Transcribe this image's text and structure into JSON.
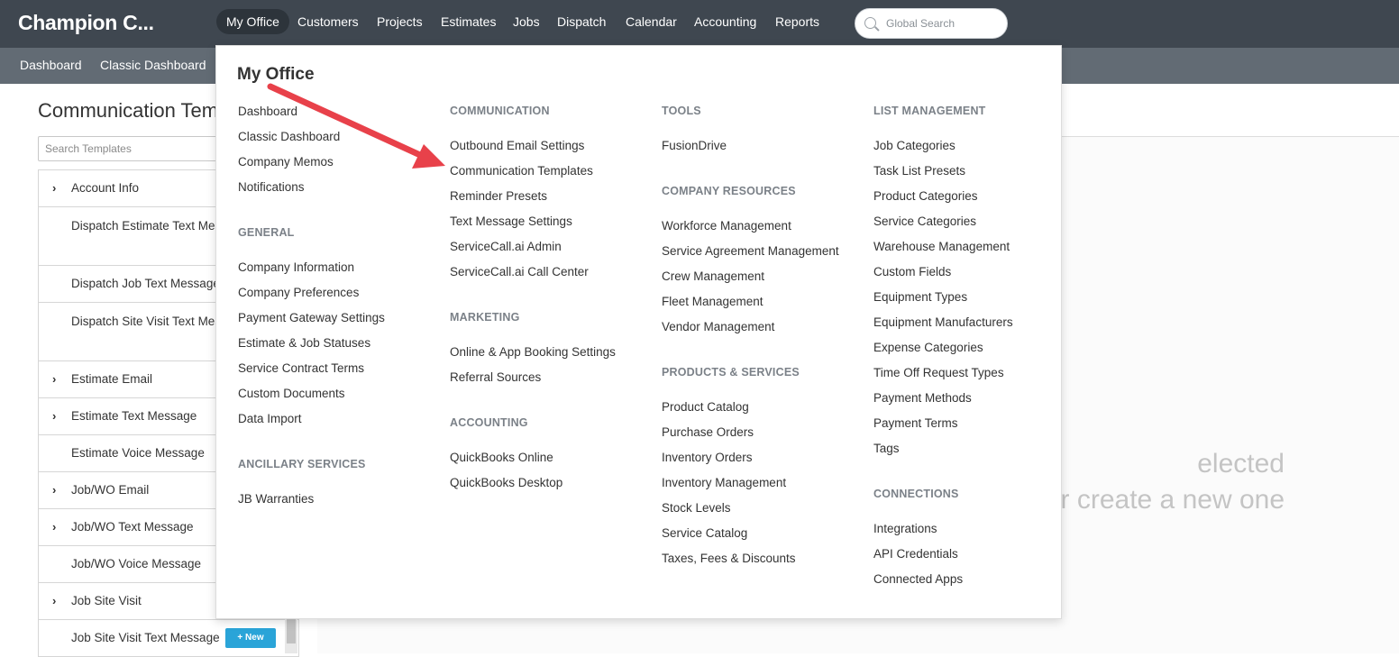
{
  "brand": "Champion C...",
  "nav": {
    "items": [
      "My Office",
      "Customers",
      "Projects",
      "Estimates",
      "Jobs",
      "Dispatch",
      "Calendar",
      "Accounting",
      "Reports"
    ],
    "active": "My Office",
    "search_placeholder": "Global Search"
  },
  "subnav": {
    "items": [
      "Dashboard",
      "Classic Dashboard"
    ]
  },
  "page": {
    "title": "Communication Tem",
    "search_placeholder": "Search Templates",
    "templates": [
      {
        "label": "Account Info",
        "expandable": true
      },
      {
        "label": "Dispatch Estimate Text Message",
        "expandable": false
      },
      {
        "label": "Dispatch Job Text Message",
        "expandable": false
      },
      {
        "label": "Dispatch Site Visit Text Message",
        "expandable": false
      },
      {
        "label": "Estimate Email",
        "expandable": true
      },
      {
        "label": "Estimate Text Message",
        "expandable": true
      },
      {
        "label": "Estimate Voice Message",
        "expandable": false
      },
      {
        "label": "Job/WO Email",
        "expandable": true
      },
      {
        "label": "Job/WO Text Message",
        "expandable": true
      },
      {
        "label": "Job/WO Voice Message",
        "expandable": false
      },
      {
        "label": "Job Site Visit",
        "expandable": true
      },
      {
        "label": "Job Site Visit Text Message",
        "expandable": false
      }
    ],
    "new_button": "New",
    "empty_line1": "elected",
    "empty_line2": "r create a new one"
  },
  "dropdown": {
    "title": "My Office",
    "col1": {
      "links_top": [
        "Dashboard",
        "Classic Dashboard",
        "Company Memos",
        "Notifications"
      ],
      "general_heading": "GENERAL",
      "general": [
        "Company Information",
        "Company Preferences",
        "Payment Gateway Settings",
        "Estimate & Job Statuses",
        "Service Contract Terms",
        "Custom Documents",
        "Data Import"
      ],
      "ancillary_heading": "ANCILLARY SERVICES",
      "ancillary": [
        "JB Warranties"
      ]
    },
    "col2": {
      "communication_heading": "COMMUNICATION",
      "communication": [
        "Outbound Email Settings",
        "Communication Templates",
        "Reminder Presets",
        "Text Message Settings",
        "ServiceCall.ai Admin",
        "ServiceCall.ai Call Center"
      ],
      "marketing_heading": "MARKETING",
      "marketing": [
        "Online & App Booking Settings",
        "Referral Sources"
      ],
      "accounting_heading": "ACCOUNTING",
      "accounting": [
        "QuickBooks Online",
        "QuickBooks Desktop"
      ]
    },
    "col3": {
      "tools_heading": "TOOLS",
      "tools": [
        "FusionDrive"
      ],
      "resources_heading": "COMPANY RESOURCES",
      "resources": [
        "Workforce Management",
        "Service Agreement Management",
        "Crew Management",
        "Fleet Management",
        "Vendor Management"
      ],
      "products_heading": "PRODUCTS & SERVICES",
      "products": [
        "Product Catalog",
        "Purchase Orders",
        "Inventory Orders",
        "Inventory Management",
        "Stock Levels",
        "Service Catalog",
        "Taxes, Fees & Discounts"
      ]
    },
    "col4": {
      "list_heading": "LIST MANAGEMENT",
      "list": [
        "Job Categories",
        "Task List Presets",
        "Product Categories",
        "Service Categories",
        "Warehouse Management",
        "Custom Fields",
        "Equipment Types",
        "Equipment Manufacturers",
        "Expense Categories",
        "Time Off Request Types",
        "Payment Methods",
        "Payment Terms",
        "Tags"
      ],
      "connections_heading": "CONNECTIONS",
      "connections": [
        "Integrations",
        "API Credentials",
        "Connected Apps"
      ]
    }
  },
  "annotation": {
    "arrow_color": "#e8414a"
  }
}
